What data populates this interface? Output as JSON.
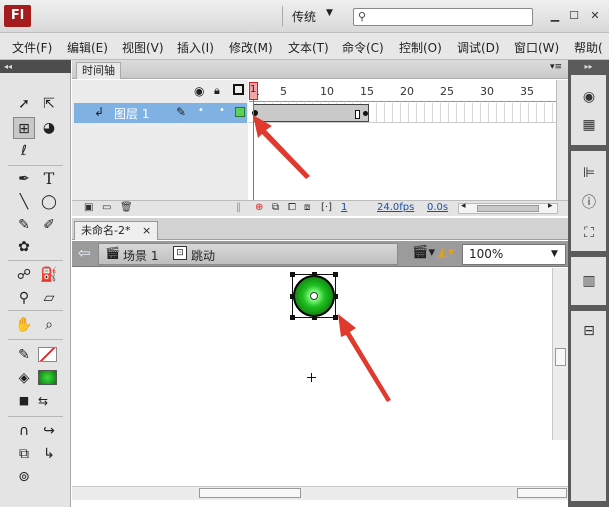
{
  "window": {
    "logo": "Fl",
    "workspace": "传统",
    "search_placeholder": ""
  },
  "menu": [
    "文件(F)",
    "编辑(E)",
    "视图(V)",
    "插入(I)",
    "修改(M)",
    "文本(T)",
    "命令(C)",
    "控制(O)",
    "调试(D)",
    "窗口(W)",
    "帮助("
  ],
  "timeline": {
    "tab_label": "时间轴",
    "layer_name": "图层 1",
    "frame_numbers": [
      "1",
      "5",
      "10",
      "15",
      "20",
      "25",
      "30",
      "35"
    ],
    "current_frame": "1",
    "fps": "24.0fps",
    "time": "0.0s"
  },
  "document": {
    "tab_label": "未命名-2*",
    "close_glyph": "×",
    "scene": "场景 1",
    "symbol": "跳动",
    "zoom": "100%"
  },
  "colors": {
    "accent": "#7fb1e3",
    "playhead": "#e24b4b",
    "fill_swatch": "#1aa01a",
    "arrow": "#e03a2f"
  },
  "icons": {
    "toolbox": [
      "selection-icon",
      "subselection-icon",
      "free-transform-icon",
      "3d-rotation-icon",
      "lasso-icon",
      "pen-icon",
      "text-icon",
      "line-icon",
      "oval-icon",
      "pencil-icon",
      "brush-icon",
      "deco-icon",
      "bone-icon",
      "paint-bucket-icon",
      "eyedropper-icon",
      "eraser-icon",
      "hand-icon",
      "zoom-icon",
      "stroke-color-icon",
      "fill-color-icon",
      "swap-colors-icon",
      "snap-magnet-icon",
      "smooth-icon",
      "straighten-icon",
      "snap-icon"
    ],
    "right_panel": [
      "color-panel-icon",
      "swatches-icon",
      "align-icon",
      "info-icon",
      "transform-icon",
      "library-icon",
      "components-icon"
    ]
  }
}
